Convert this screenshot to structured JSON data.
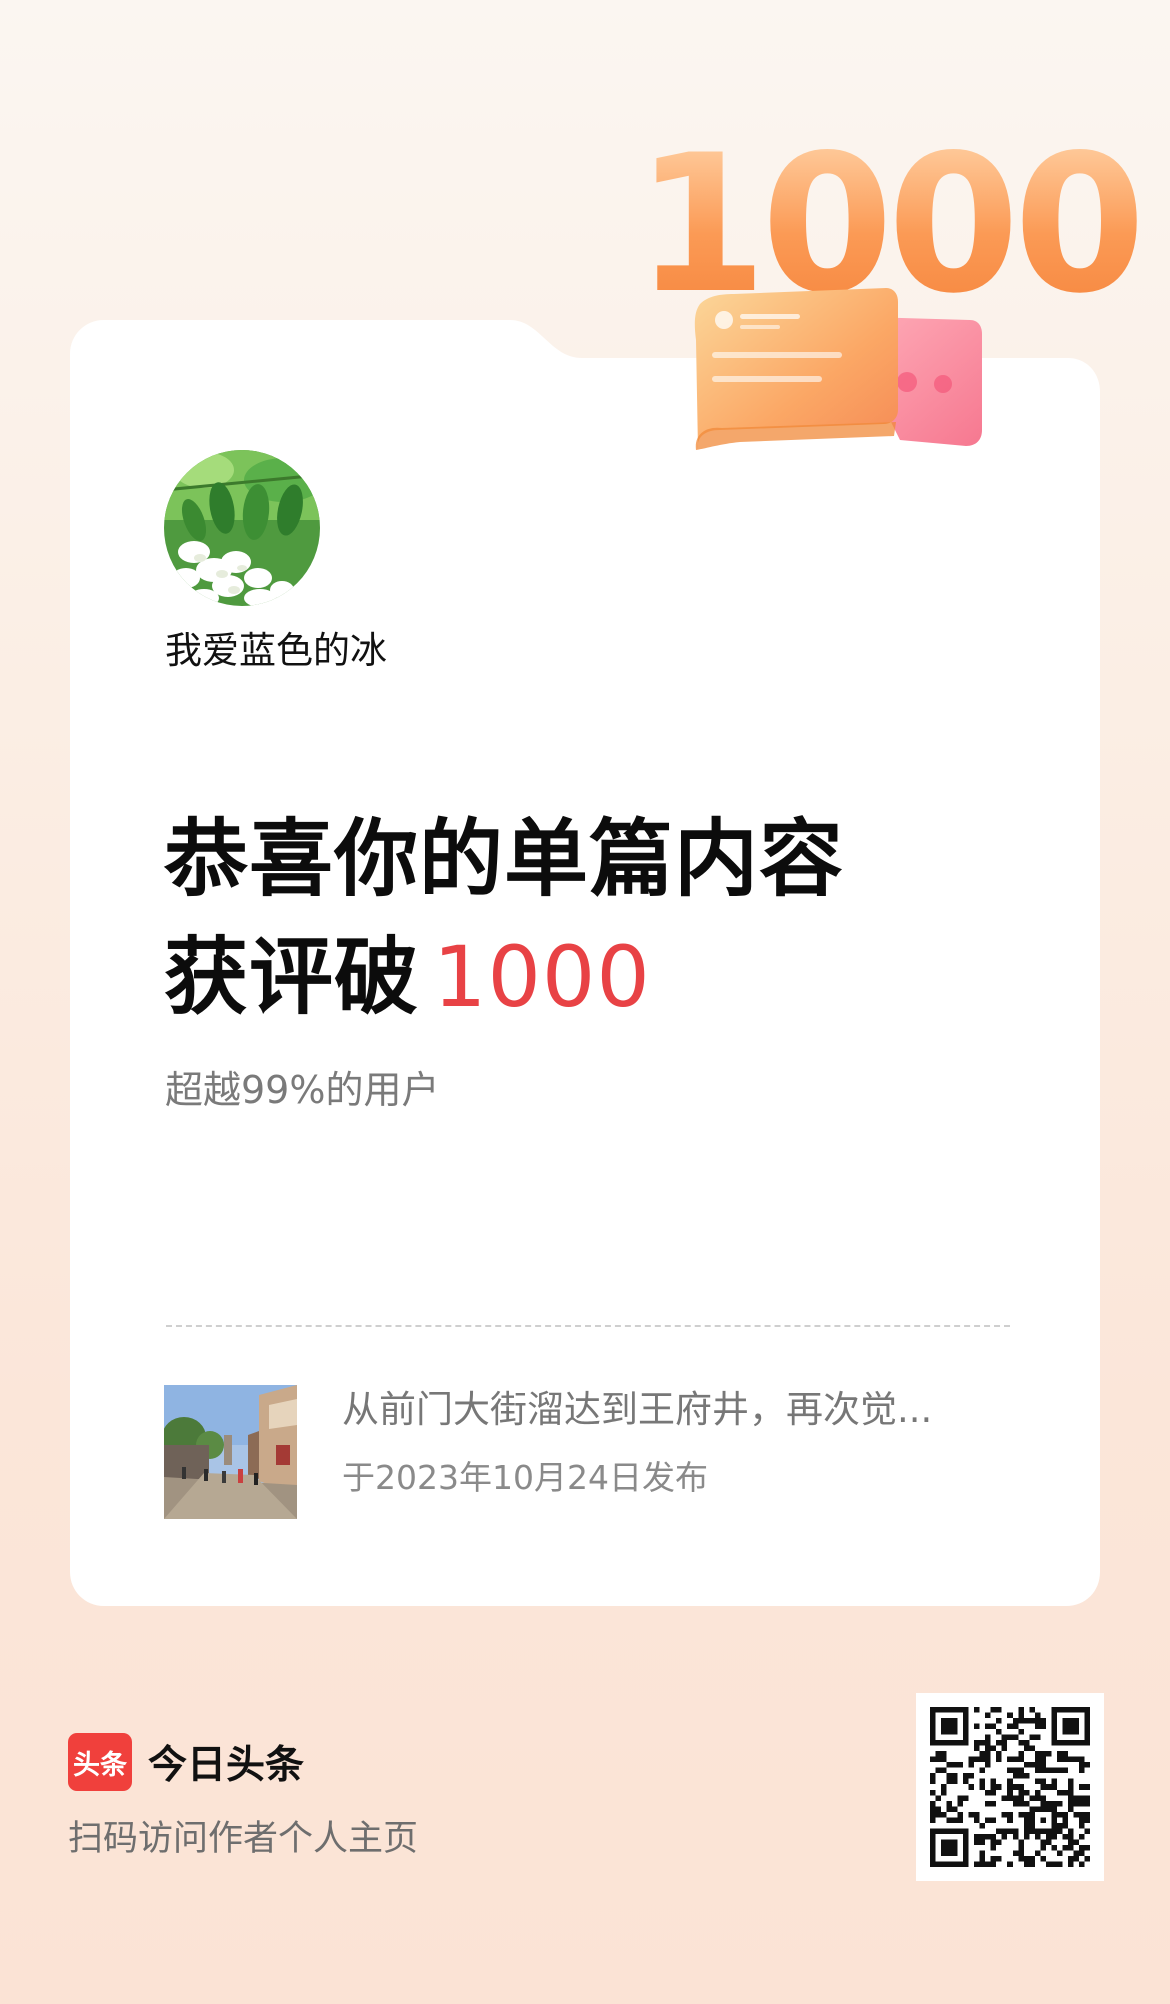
{
  "badge": {
    "number": "1000"
  },
  "author": {
    "name": "我爱蓝色的冰"
  },
  "headline": {
    "line1": "恭喜你的单篇内容",
    "line2_prefix": "获评破",
    "line2_number": "1000"
  },
  "stats": {
    "text": "超越99%的用户"
  },
  "article": {
    "title": "从前门大街溜达到王府井，再次觉...",
    "date": "于2023年10月24日发布"
  },
  "footer": {
    "logo_text": "头条",
    "app_name": "今日头条",
    "scan_text": "扫码访问作者个人主页"
  },
  "colors": {
    "accent": "#e84245",
    "brand": "#f0403c",
    "badge": "#fb9a55"
  }
}
